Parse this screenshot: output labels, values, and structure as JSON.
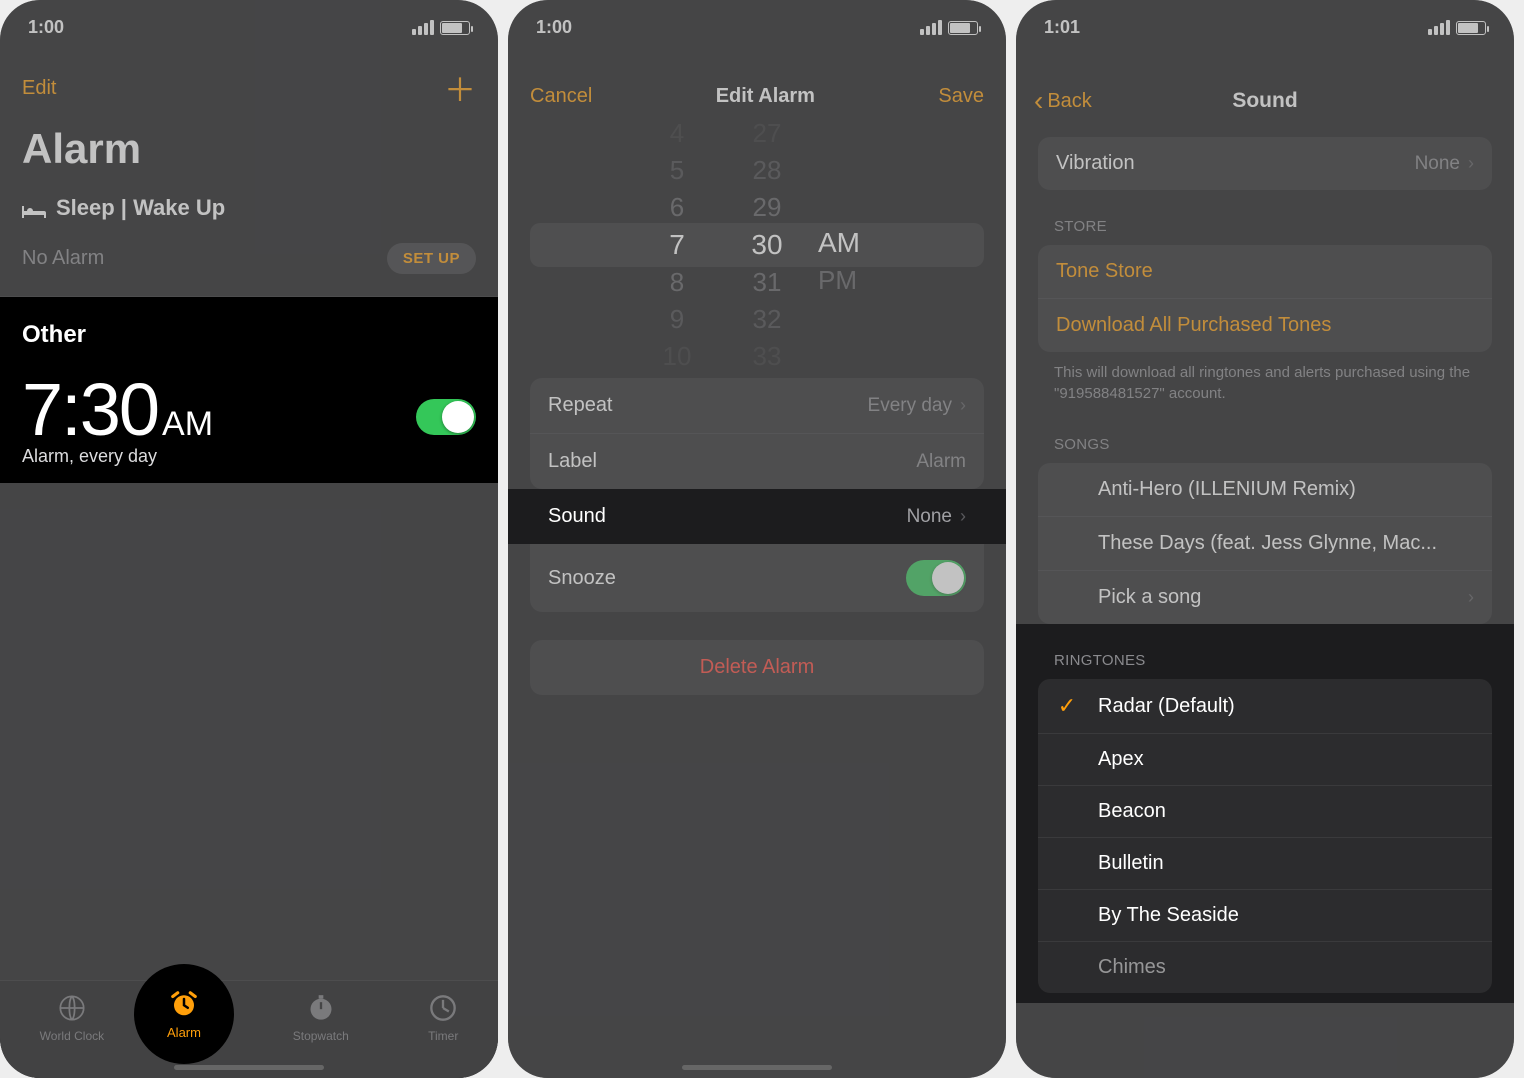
{
  "screen1": {
    "status_time": "1:00",
    "edit": "Edit",
    "title": "Alarm",
    "sleep_wake": "Sleep | Wake Up",
    "no_alarm": "No Alarm",
    "setup": "SET UP",
    "other": "Other",
    "alarm_time": "7:30",
    "alarm_ampm": "AM",
    "alarm_sub": "Alarm, every day",
    "tabs": {
      "world_clock": "World Clock",
      "alarm": "Alarm",
      "stopwatch": "Stopwatch",
      "timer": "Timer"
    }
  },
  "screen2": {
    "status_time": "1:00",
    "cancel": "Cancel",
    "title": "Edit Alarm",
    "save": "Save",
    "picker": {
      "hours": [
        "4",
        "5",
        "6",
        "7",
        "8",
        "9",
        "10"
      ],
      "minutes": [
        "27",
        "28",
        "29",
        "30",
        "31",
        "32",
        "33"
      ],
      "am": "AM",
      "pm": "PM"
    },
    "rows": {
      "repeat_label": "Repeat",
      "repeat_value": "Every day",
      "label_label": "Label",
      "label_value": "Alarm",
      "sound_label": "Sound",
      "sound_value": "None",
      "snooze_label": "Snooze"
    },
    "delete": "Delete Alarm"
  },
  "screen3": {
    "status_time": "1:01",
    "back": "Back",
    "title": "Sound",
    "vibration_label": "Vibration",
    "vibration_value": "None",
    "store_header": "STORE",
    "tone_store": "Tone Store",
    "download_all": "Download All Purchased Tones",
    "footnote": "This will download all ringtones and alerts purchased using the \"919588481527\" account.",
    "songs_header": "SONGS",
    "songs": [
      "Anti-Hero (ILLENIUM Remix)",
      "These Days (feat. Jess Glynne, Mac..."
    ],
    "pick_song": "Pick a song",
    "ringtones_header": "RINGTONES",
    "ringtones": [
      "Radar (Default)",
      "Apex",
      "Beacon",
      "Bulletin",
      "By The Seaside",
      "Chimes"
    ]
  }
}
